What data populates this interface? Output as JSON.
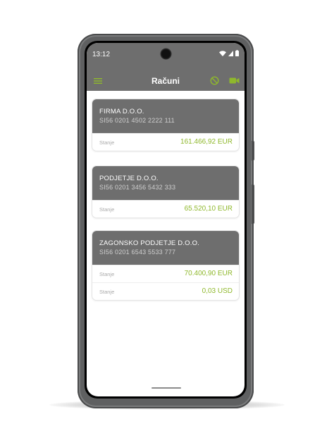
{
  "status": {
    "time": "13:12"
  },
  "header": {
    "title": "Računi"
  },
  "accounts": [
    {
      "name": "FIRMA D.O.O.",
      "iban": "SI56 0201 4502 2222 111",
      "balances": [
        {
          "label": "Stanje",
          "value": "161.466,92 EUR"
        }
      ]
    },
    {
      "name": "PODJETJE D.O.O.",
      "iban": "SI56 0201 3456 5432 333",
      "balances": [
        {
          "label": "Stanje",
          "value": "65.520,10 EUR"
        }
      ]
    },
    {
      "name": "ZAGONSKO PODJETJE D.O.O.",
      "iban": "SI56 0201 6543 5533 777",
      "balances": [
        {
          "label": "Stanje",
          "value": "70.400,90 EUR"
        },
        {
          "label": "Stanje",
          "value": "0,03 USD"
        }
      ]
    }
  ],
  "icons": {
    "menu": "hamburger-menu-icon",
    "block": "block-icon",
    "video": "video-camera-icon",
    "wifi": "wifi-icon",
    "signal": "signal-icon",
    "battery": "battery-icon"
  },
  "colors": {
    "accent": "#8fb82c",
    "header": "#6e6e6e",
    "phone_body": "#5f6061"
  }
}
